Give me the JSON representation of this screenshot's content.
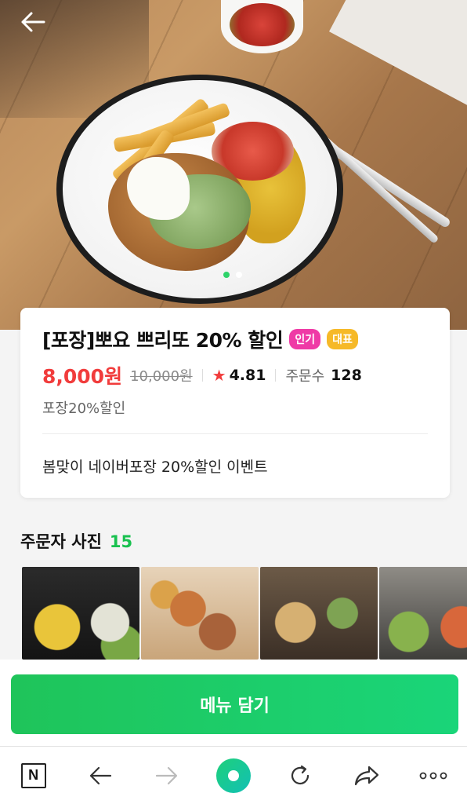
{
  "hero": {
    "back_icon": "arrow-left-icon",
    "slide_count": 2,
    "active_slide": 1
  },
  "product": {
    "title": "[포장]뽀요 쁘리또 20% 할인",
    "badges": [
      {
        "label": "인기",
        "color": "#ef3aa6"
      },
      {
        "label": "대표",
        "color": "#f6b928"
      }
    ],
    "price": "8,000원",
    "original_price": "10,000원",
    "rating": "4.81",
    "order_label": "주문수",
    "order_count": "128",
    "subtitle": "포장20%할인",
    "description": "봄맞이 네이버포장 20%할인 이벤트"
  },
  "photos": {
    "title": "주문자 사진",
    "count": "15"
  },
  "cart": {
    "label": "메뉴 담기",
    "color": "#1fc45a"
  },
  "browser_bar": {
    "items": [
      "naver-n-icon",
      "back-arrow-icon",
      "forward-arrow-icon",
      "home-icon",
      "refresh-icon",
      "share-icon",
      "more-icon"
    ],
    "n_label": "N"
  },
  "colors": {
    "price": "#f13c3c",
    "accent_green": "#19c14f"
  }
}
